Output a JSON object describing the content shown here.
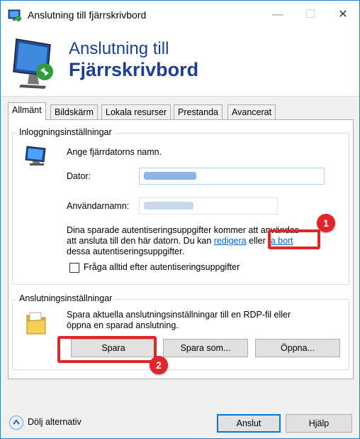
{
  "window": {
    "title": "Anslutning till fjärrskrivbord",
    "controls": {
      "minimize": "—",
      "maximize": "☐",
      "close": "✕"
    }
  },
  "banner": {
    "line1": "Anslutning till",
    "line2": "Fjärrskrivbord"
  },
  "tabs": [
    {
      "label": "Allmänt",
      "active": true
    },
    {
      "label": "Bildskärm"
    },
    {
      "label": "Lokala resurser"
    },
    {
      "label": "Prestanda"
    },
    {
      "label": "Avancerat"
    }
  ],
  "login": {
    "group_title": "Inloggningsinställningar",
    "prompt": "Ange fjärrdatorns namn.",
    "computer_label": "Dator:",
    "username_label": "Användarnamn:",
    "credentials_line1": "Dina sparade autentiseringsuppgifter kommer att användas",
    "credentials_line2_pre": "att ansluta till den här datorn. Du kan ",
    "edit_link": "redigera",
    "credentials_or": " eller ",
    "delete_link": "ta bort",
    "credentials_line3": "dessa autentiseringsuppgifter.",
    "always_ask_label": "Fråga alltid efter autentiseringsuppgifter",
    "always_ask_checked": false
  },
  "connection": {
    "group_title": "Anslutningsinställningar",
    "desc_line1": "Spara aktuella anslutningsinställningar till en RDP-fil eller",
    "desc_line2": "öppna en sparad anslutning.",
    "save_button": "Spara",
    "save_as_button": "Spara som...",
    "open_button": "Öppna..."
  },
  "footer": {
    "hide_options": "Dölj alternativ",
    "connect_button": "Anslut",
    "help_button": "Hjälp"
  },
  "annotations": {
    "badge1": "1",
    "badge2": "2",
    "color": "#e0262a"
  }
}
